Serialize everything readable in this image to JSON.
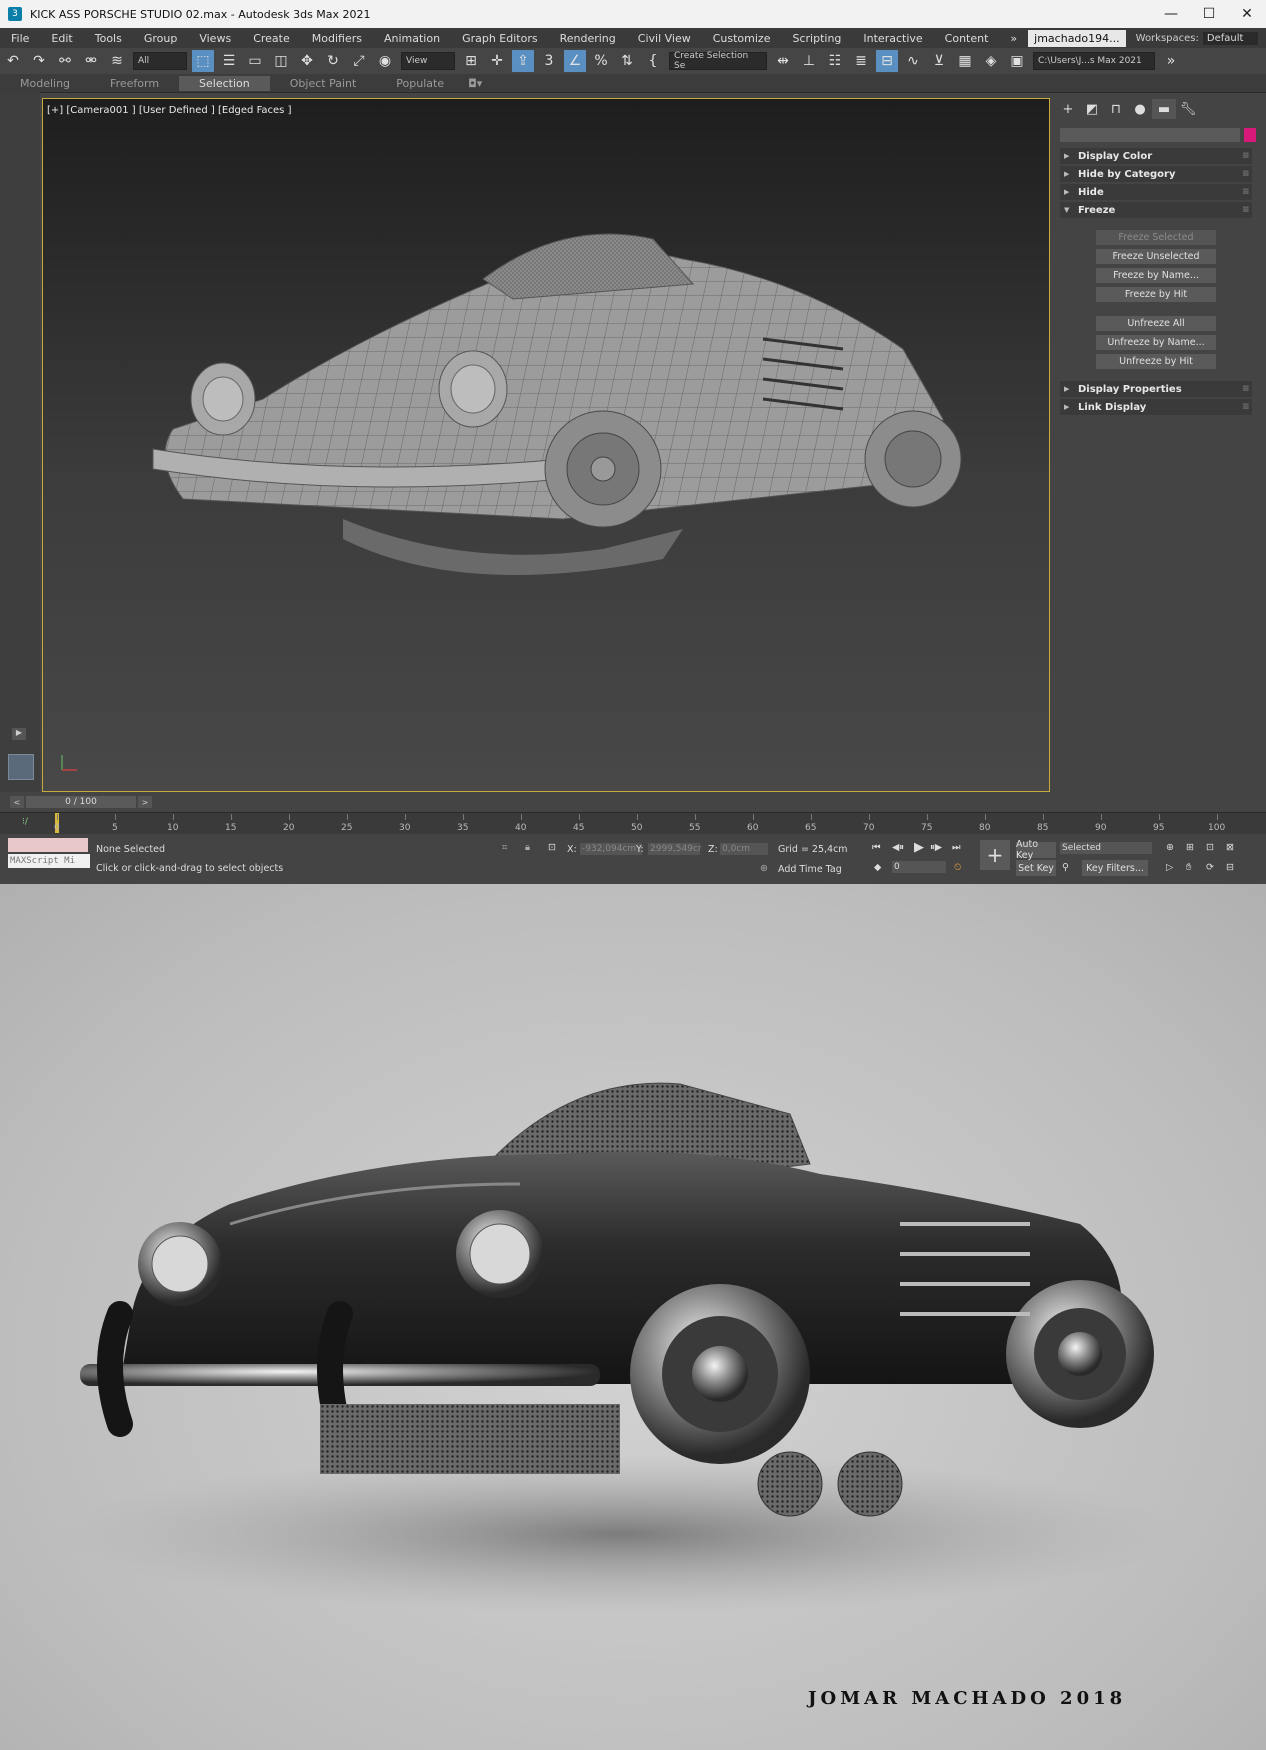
{
  "window": {
    "title": "KICK ASS PORSCHE STUDIO 02.max - Autodesk 3ds Max 2021",
    "minimize": "—",
    "maximize": "☐",
    "close": "✕"
  },
  "menu": {
    "items": [
      "File",
      "Edit",
      "Tools",
      "Group",
      "Views",
      "Create",
      "Modifiers",
      "Animation",
      "Graph Editors",
      "Rendering",
      "Civil View",
      "Customize",
      "Scripting",
      "Interactive",
      "Content"
    ],
    "overflow": "»",
    "user": "jmachado194...",
    "workspaces_label": "Workspaces:",
    "workspace_value": "Default"
  },
  "toolbar": {
    "filter_value": "All",
    "view_value": "View",
    "selection_set": "Create Selection Se",
    "path_value": "C:\\Users\\J...s Max 2021"
  },
  "ribbon": {
    "tabs": [
      "Modeling",
      "Freeform",
      "Selection",
      "Object Paint",
      "Populate"
    ],
    "active": "Selection"
  },
  "viewport": {
    "label": "[+] [Camera001 ] [User Defined ] [Edged Faces ]",
    "frame_color": "#c8aa3a"
  },
  "command_panel": {
    "accent_swatch": "#d8197a",
    "rollouts_top": [
      "Display Color",
      "Hide by Category",
      "Hide",
      "Freeze"
    ],
    "freeze_buttons": [
      "Freeze Selected",
      "Freeze Unselected",
      "Freeze by Name...",
      "Freeze by Hit"
    ],
    "unfreeze_buttons": [
      "Unfreeze All",
      "Unfreeze by Name...",
      "Unfreeze by Hit"
    ],
    "rollouts_bottom": [
      "Display Properties",
      "Link Display"
    ]
  },
  "timeline": {
    "frame": "0 / 100",
    "ticks": [
      "0",
      "5",
      "10",
      "15",
      "20",
      "25",
      "30",
      "35",
      "40",
      "45",
      "50",
      "55",
      "60",
      "65",
      "70",
      "75",
      "80",
      "85",
      "90",
      "95",
      "100"
    ]
  },
  "status": {
    "maxscript": "MAXScript Mi",
    "selection": "None Selected",
    "prompt": "Click or click-and-drag to select objects",
    "x_label": "X:",
    "x_value": "-932,094cm",
    "y_label": "Y:",
    "y_value": "2999,549cr",
    "z_label": "Z:",
    "z_value": "0,0cm",
    "grid": "Grid = 25,4cm",
    "add_time_tag": "Add Time Tag",
    "auto_key": "Auto Key",
    "set_key": "Set Key",
    "key_mode": "Selected",
    "key_filters": "Key Filters...",
    "frame_field": "0"
  },
  "render": {
    "signature": "JOMAR MACHADO 2018"
  }
}
